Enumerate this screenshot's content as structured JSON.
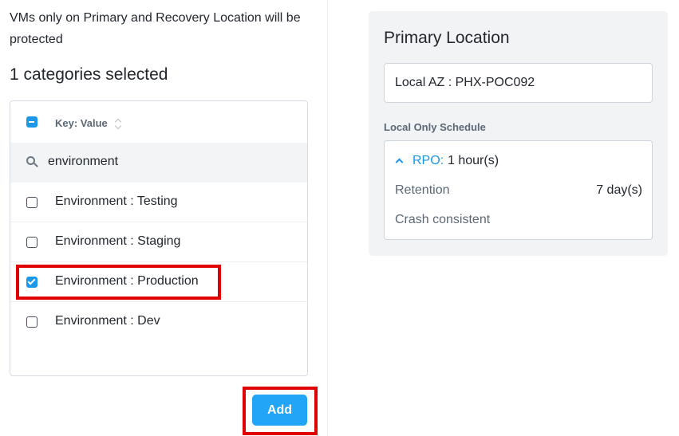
{
  "notice": "VMs only on Primary and Recovery Location will be protected",
  "selected_count": "1 categories selected",
  "category_list": {
    "header_label": "Key: Value",
    "search_value": "environment",
    "items": [
      {
        "label": "Environment : Testing",
        "checked": false
      },
      {
        "label": "Environment : Staging",
        "checked": false
      },
      {
        "label": "Environment : Production",
        "checked": true
      },
      {
        "label": "Environment : Dev",
        "checked": false
      }
    ]
  },
  "add_button_label": "Add",
  "primary_location": {
    "title": "Primary Location",
    "location_value": "Local AZ : PHX-POC092",
    "schedule_label": "Local Only Schedule",
    "rpo_label": "RPO:",
    "rpo_value": "1 hour(s)",
    "retention_label": "Retention",
    "retention_value": "7 day(s)",
    "consistency": "Crash consistent"
  },
  "colors": {
    "accent": "#1b98ea",
    "button": "#22a5f7",
    "highlight": "#e00000",
    "card_bg": "#f2f3f5"
  },
  "icons": [
    "indeterminate-checkbox-icon",
    "sort-icon",
    "search-icon",
    "checkbox-icon",
    "chevron-up-icon"
  ]
}
